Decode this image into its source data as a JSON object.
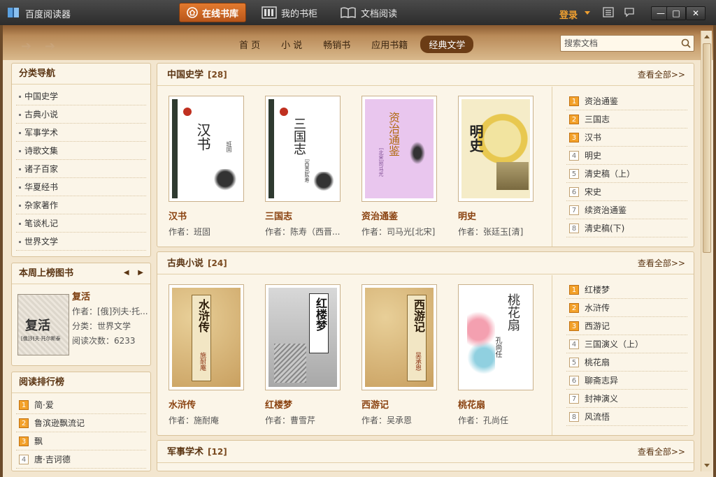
{
  "app": {
    "title": "百度阅读器"
  },
  "topnav": [
    {
      "label": "在线书库",
      "icon": "home-icon",
      "active": true
    },
    {
      "label": "我的书柜",
      "icon": "bookshelf-icon",
      "active": false
    },
    {
      "label": "文档阅读",
      "icon": "open-book-icon",
      "active": false
    }
  ],
  "header": {
    "login": "登录"
  },
  "tabs": [
    "首 页",
    "小 说",
    "畅销书",
    "应用书籍",
    "经典文学"
  ],
  "active_tab": "经典文学",
  "search": {
    "placeholder": "搜索文档"
  },
  "sidebar": {
    "nav_title": "分类导航",
    "nav_items": [
      "中国史学",
      "古典小说",
      "军事学术",
      "诗歌文集",
      "诸子百家",
      "华夏经书",
      "杂家著作",
      "笔谈札记",
      "世界文学"
    ],
    "weekly": {
      "title": "本周上榜图书",
      "book_title": "复活",
      "author": "作者：[俄]列夫·托...",
      "category": "分类：世界文学",
      "reads": "阅读次数：6233",
      "cover_text": "复活",
      "cover_sub": "[俄]列夫·托尔斯泰"
    },
    "ranking": {
      "title": "阅读排行榜",
      "items": [
        {
          "num": "1",
          "label": "简·爱"
        },
        {
          "num": "2",
          "label": "鲁滨逊飘流记"
        },
        {
          "num": "3",
          "label": "飘"
        },
        {
          "num": "4",
          "label": "唐·吉诃德"
        }
      ]
    }
  },
  "sections": [
    {
      "title": "中国史学",
      "count": "[28]",
      "more": "查看全部>>",
      "books": [
        {
          "title": "汉书",
          "author": "作者：班固",
          "cover": "汉书",
          "cover_sub": "班固"
        },
        {
          "title": "三国志",
          "author": "作者：陈寿（西晋...",
          "cover": "三国志",
          "cover_sub": "[西晋]陈寿"
        },
        {
          "title": "资治通鉴",
          "author": "作者：司马光[北宋]",
          "cover": "资治通鉴",
          "cover_sub": "[北宋]司马光"
        },
        {
          "title": "明史",
          "author": "作者：张廷玉[清]",
          "cover": "明史",
          "cover_sub": ""
        }
      ],
      "ranking": [
        {
          "num": "1",
          "label": "资治通鉴"
        },
        {
          "num": "2",
          "label": "三国志"
        },
        {
          "num": "3",
          "label": "汉书"
        },
        {
          "num": "4",
          "label": "明史"
        },
        {
          "num": "5",
          "label": "清史稿（上）"
        },
        {
          "num": "6",
          "label": "宋史"
        },
        {
          "num": "7",
          "label": "续资治通鉴"
        },
        {
          "num": "8",
          "label": "清史稿(下)"
        }
      ]
    },
    {
      "title": "古典小说",
      "count": "[24]",
      "more": "查看全部>>",
      "books": [
        {
          "title": "水浒传",
          "author": "作者：施耐庵",
          "cover": "水浒传",
          "cover_sub": "施耐庵"
        },
        {
          "title": "红楼梦",
          "author": "作者：曹雪芹",
          "cover": "红楼梦",
          "cover_sub": ""
        },
        {
          "title": "西游记",
          "author": "作者：吴承恩",
          "cover": "西游记",
          "cover_sub": "吴承恩"
        },
        {
          "title": "桃花扇",
          "author": "作者：孔尚任",
          "cover": "桃花扇",
          "cover_sub": "孔尚任"
        }
      ],
      "ranking": [
        {
          "num": "1",
          "label": "红楼梦"
        },
        {
          "num": "2",
          "label": "水浒传"
        },
        {
          "num": "3",
          "label": "西游记"
        },
        {
          "num": "4",
          "label": "三国演义（上）"
        },
        {
          "num": "5",
          "label": "桃花扇"
        },
        {
          "num": "6",
          "label": "聊斋志异"
        },
        {
          "num": "7",
          "label": "封神演义"
        },
        {
          "num": "8",
          "label": "风流悟"
        }
      ]
    },
    {
      "title": "军事学术",
      "count": "[12]",
      "more": "查看全部>>"
    }
  ]
}
